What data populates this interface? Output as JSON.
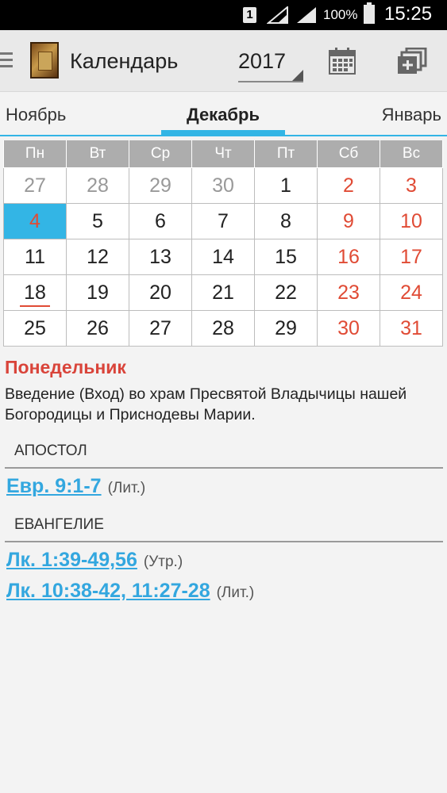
{
  "status_bar": {
    "sim": "1",
    "battery": "100%",
    "time": "15:25"
  },
  "app_bar": {
    "title": "Календарь",
    "year": "2017",
    "icons": [
      "menu-icon",
      "app-logo-icon",
      "calendar-icon",
      "copy-icon"
    ]
  },
  "month_tabs": {
    "prev": "Ноябрь",
    "current": "Декабрь",
    "next": "Январь"
  },
  "calendar": {
    "weekdays": [
      "Пн",
      "Вт",
      "Ср",
      "Чт",
      "Пт",
      "Сб",
      "Вс"
    ],
    "weeks": [
      [
        "27",
        "28",
        "29",
        "30",
        "1",
        "2",
        "3"
      ],
      [
        "4",
        "5",
        "6",
        "7",
        "8",
        "9",
        "10"
      ],
      [
        "11",
        "12",
        "13",
        "14",
        "15",
        "16",
        "17"
      ],
      [
        "18",
        "19",
        "20",
        "21",
        "22",
        "23",
        "24"
      ],
      [
        "25",
        "26",
        "27",
        "28",
        "29",
        "30",
        "31"
      ]
    ],
    "selected_day": "4",
    "today_day": "18"
  },
  "day": {
    "title": "Понедельник",
    "feast": "Введение (Вход) во храм Пресвятой Владычицы нашей Богородицы и Приснодевы Марии."
  },
  "readings": {
    "apostle_header": "АПОСТОЛ",
    "apostle": [
      {
        "ref": "Евр. 9:1-7",
        "note": "(Лит.)"
      }
    ],
    "gospel_header": "ЕВАНГЕЛИЕ",
    "gospel": [
      {
        "ref": "Лк. 1:39-49,56",
        "note": "(Утр.)"
      },
      {
        "ref": "Лк. 10:38-42, 11:27-28",
        "note": "(Лит.)"
      }
    ]
  },
  "colors": {
    "accent": "#33b5e5",
    "weekend": "#e04b35",
    "title_red": "#d9443a"
  }
}
